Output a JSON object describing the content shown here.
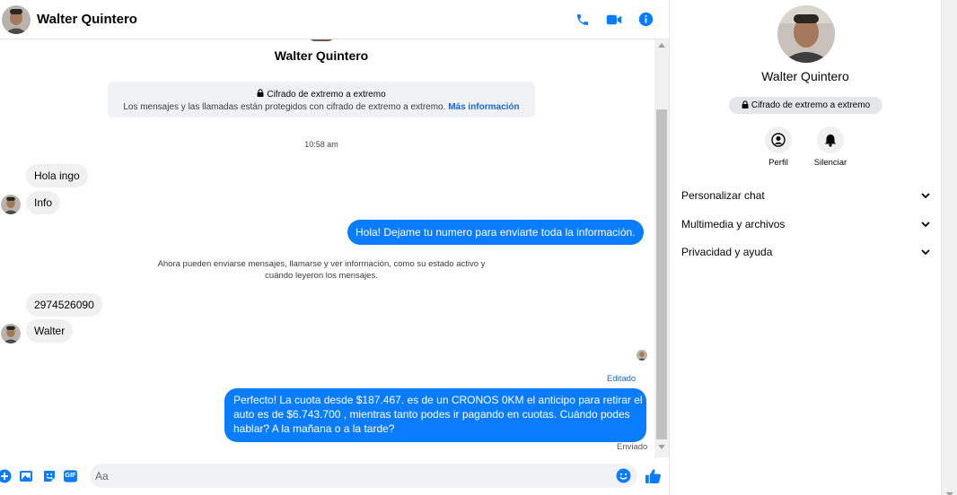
{
  "contact": {
    "name": "Walter Quintero"
  },
  "header": {
    "name": "Walter Quintero",
    "icons": [
      "phone-icon",
      "video-icon",
      "info-icon"
    ],
    "accent": "#0a7cff"
  },
  "chat": {
    "title": "Walter Quintero",
    "encryption": {
      "title": "Cifrado de extremo a extremo",
      "subtitle": "Los mensajes y las llamadas están protegidos con cifrado de extremo a extremo.",
      "link": "Más información"
    },
    "timestamp": "10:58 am",
    "messages": [
      {
        "from": "them",
        "text": "Hola ingo"
      },
      {
        "from": "them",
        "text": "Info"
      },
      {
        "from": "me",
        "text": "Hola! Dejame tu numero  para enviarte toda la información."
      },
      {
        "from": "system",
        "text": "Ahora pueden enviarse mensajes, llamarse y ver información, como su estado activo y cuándo leyeron los mensajes."
      },
      {
        "from": "them",
        "text": "2974526090"
      },
      {
        "from": "them",
        "text": "Walter"
      },
      {
        "from": "me",
        "lines": [
          "Perfecto! La cuota desde $187.467. es de un CRONOS 0KM el anticipo para retirar el",
          "auto es de $6.743.700 , mientras tanto podes ir pagando en cuotas. Cuándo podes",
          "hablar? A la mañana o a la tarde?"
        ]
      }
    ],
    "edited_label": "Editado",
    "sent_label": "Enviado"
  },
  "composer": {
    "placeholder": "Aa",
    "icons": [
      "plus-icon",
      "image-icon",
      "sticker-icon",
      "gif-icon",
      "emoji-icon",
      "thumbs-up-icon"
    ],
    "gif_label": "GIF"
  },
  "right_panel": {
    "name": "Walter Quintero",
    "encryption_badge": "Cifrado de extremo a extremo",
    "actions": [
      {
        "label": "Perfil",
        "icon": "profile-icon"
      },
      {
        "label": "Silenciar",
        "icon": "bell-icon"
      }
    ],
    "sections": [
      {
        "label": "Personalizar chat"
      },
      {
        "label": "Multimedia y archivos"
      },
      {
        "label": "Privacidad y ayuda"
      }
    ]
  }
}
